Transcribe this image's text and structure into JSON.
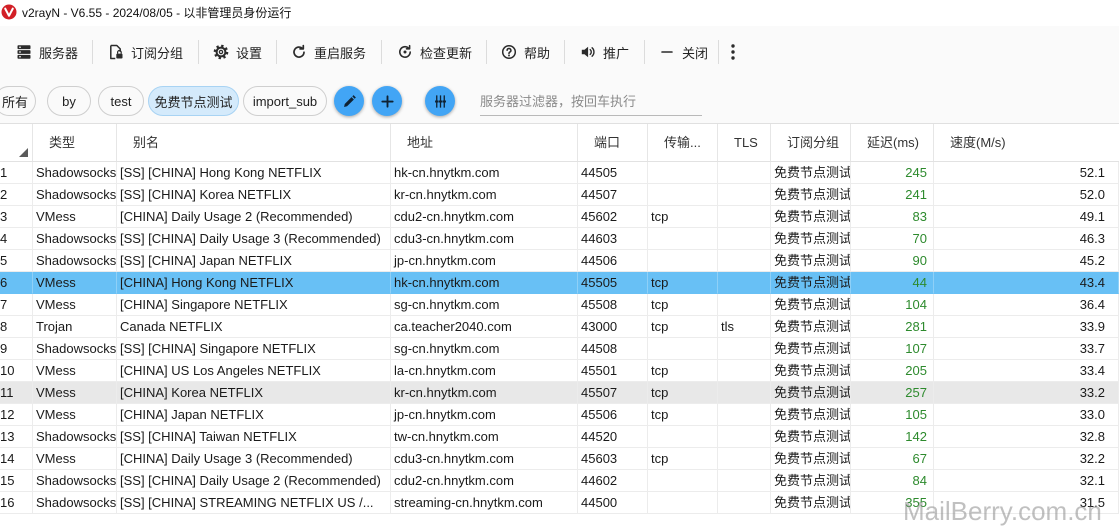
{
  "window": {
    "title": "v2rayN - V6.55 - 2024/08/05 - 以非管理员身份运行",
    "icon": "v2rayn-logo-icon"
  },
  "toolbar": {
    "items": [
      {
        "label": "服务器",
        "icon": "server-icon"
      },
      {
        "label": "订阅分组",
        "icon": "subscription-icon"
      },
      {
        "label": "设置",
        "icon": "gear-icon"
      },
      {
        "label": "重启服务",
        "icon": "restart-icon"
      },
      {
        "label": "检查更新",
        "icon": "check-update-icon"
      },
      {
        "label": "帮助",
        "icon": "help-icon"
      },
      {
        "label": "推广",
        "icon": "speaker-icon"
      },
      {
        "label": "关闭",
        "icon": "minus-icon"
      }
    ],
    "overflow_icon": "more-vertical-icon"
  },
  "subscription_groups": {
    "chips": [
      {
        "label": "所有",
        "selected": false
      },
      {
        "label": "by",
        "selected": false
      },
      {
        "label": "test",
        "selected": false
      },
      {
        "label": "免费节点测试",
        "selected": true
      },
      {
        "label": "import_sub",
        "selected": false
      }
    ],
    "actions": {
      "edit_icon": "pencil-icon",
      "add_icon": "plus-icon",
      "filter_icon": "sliders-icon"
    },
    "filter_input": {
      "value": "",
      "placeholder": "服务器过滤器，按回车执行"
    }
  },
  "table": {
    "sort_indicator_icon": "sort-triangle-icon",
    "columns": [
      "类型",
      "别名",
      "地址",
      "端口",
      "传输...",
      "TLS",
      "订阅分组",
      "延迟(ms)",
      "速度(M/s)"
    ],
    "rows": [
      {
        "n": "1",
        "type": "Shadowsocks",
        "alias": "[SS] [CHINA] Hong Kong NETFLIX",
        "address": "hk-cn.hnytkm.com",
        "port": "44505",
        "transport": "",
        "tls": "",
        "group": "免费节点测试",
        "latency": "245",
        "speed": "52.1"
      },
      {
        "n": "2",
        "type": "Shadowsocks",
        "alias": "[SS] [CHINA] Korea NETFLIX",
        "address": "kr-cn.hnytkm.com",
        "port": "44507",
        "transport": "",
        "tls": "",
        "group": "免费节点测试",
        "latency": "241",
        "speed": "52.0"
      },
      {
        "n": "3",
        "type": "VMess",
        "alias": "[CHINA] Daily Usage 2 (Recommended)",
        "address": "cdu2-cn.hnytkm.com",
        "port": "45602",
        "transport": "tcp",
        "tls": "",
        "group": "免费节点测试",
        "latency": "83",
        "speed": "49.1"
      },
      {
        "n": "4",
        "type": "Shadowsocks",
        "alias": "[SS] [CHINA] Daily Usage 3 (Recommended)",
        "address": "cdu3-cn.hnytkm.com",
        "port": "44603",
        "transport": "",
        "tls": "",
        "group": "免费节点测试",
        "latency": "70",
        "speed": "46.3"
      },
      {
        "n": "5",
        "type": "Shadowsocks",
        "alias": "[SS] [CHINA] Japan NETFLIX",
        "address": "jp-cn.hnytkm.com",
        "port": "44506",
        "transport": "",
        "tls": "",
        "group": "免费节点测试",
        "latency": "90",
        "speed": "45.2"
      },
      {
        "n": "6",
        "type": "VMess",
        "alias": "[CHINA] Hong Kong NETFLIX",
        "address": "hk-cn.hnytkm.com",
        "port": "45505",
        "transport": "tcp",
        "tls": "",
        "group": "免费节点测试",
        "latency": "44",
        "speed": "43.4",
        "selected": true
      },
      {
        "n": "7",
        "type": "VMess",
        "alias": "[CHINA] Singapore NETFLIX",
        "address": "sg-cn.hnytkm.com",
        "port": "45508",
        "transport": "tcp",
        "tls": "",
        "group": "免费节点测试",
        "latency": "104",
        "speed": "36.4"
      },
      {
        "n": "8",
        "type": "Trojan",
        "alias": "Canada NETFLIX",
        "address": "ca.teacher2040.com",
        "port": "43000",
        "transport": "tcp",
        "tls": "tls",
        "group": "免费节点测试",
        "latency": "281",
        "speed": "33.9"
      },
      {
        "n": "9",
        "type": "Shadowsocks",
        "alias": "[SS] [CHINA] Singapore NETFLIX",
        "address": "sg-cn.hnytkm.com",
        "port": "44508",
        "transport": "",
        "tls": "",
        "group": "免费节点测试",
        "latency": "107",
        "speed": "33.7"
      },
      {
        "n": "10",
        "type": "VMess",
        "alias": "[CHINA] US Los Angeles NETFLIX",
        "address": "la-cn.hnytkm.com",
        "port": "45501",
        "transport": "tcp",
        "tls": "",
        "group": "免费节点测试",
        "latency": "205",
        "speed": "33.4"
      },
      {
        "n": "11",
        "type": "VMess",
        "alias": "[CHINA] Korea NETFLIX",
        "address": "kr-cn.hnytkm.com",
        "port": "45507",
        "transport": "tcp",
        "tls": "",
        "group": "免费节点测试",
        "latency": "257",
        "speed": "33.2",
        "hovered": true
      },
      {
        "n": "12",
        "type": "VMess",
        "alias": "[CHINA] Japan NETFLIX",
        "address": "jp-cn.hnytkm.com",
        "port": "45506",
        "transport": "tcp",
        "tls": "",
        "group": "免费节点测试",
        "latency": "105",
        "speed": "33.0"
      },
      {
        "n": "13",
        "type": "Shadowsocks",
        "alias": "[SS] [CHINA] Taiwan NETFLIX",
        "address": "tw-cn.hnytkm.com",
        "port": "44520",
        "transport": "",
        "tls": "",
        "group": "免费节点测试",
        "latency": "142",
        "speed": "32.8"
      },
      {
        "n": "14",
        "type": "VMess",
        "alias": "[CHINA] Daily Usage 3 (Recommended)",
        "address": "cdu3-cn.hnytkm.com",
        "port": "45603",
        "transport": "tcp",
        "tls": "",
        "group": "免费节点测试",
        "latency": "67",
        "speed": "32.2"
      },
      {
        "n": "15",
        "type": "Shadowsocks",
        "alias": "[SS] [CHINA] Daily Usage 2 (Recommended)",
        "address": "cdu2-cn.hnytkm.com",
        "port": "44602",
        "transport": "",
        "tls": "",
        "group": "免费节点测试",
        "latency": "84",
        "speed": "32.1"
      },
      {
        "n": "16",
        "type": "Shadowsocks",
        "alias": "[SS] [CHINA] STREAMING NETFLIX US /...",
        "address": "streaming-cn.hnytkm.com",
        "port": "44500",
        "transport": "",
        "tls": "",
        "group": "免费节点测试",
        "latency": "355",
        "speed": "31.5"
      }
    ]
  },
  "colors": {
    "selected_row": "#68c0f5",
    "hovered_row": "#e8e8e8",
    "latency_text": "#2d8a2d",
    "chip_selected": "#d4eafb",
    "action_button": "#42a5f5",
    "app_icon": "#d21f26"
  },
  "watermark": "MailBerry.com.cn"
}
